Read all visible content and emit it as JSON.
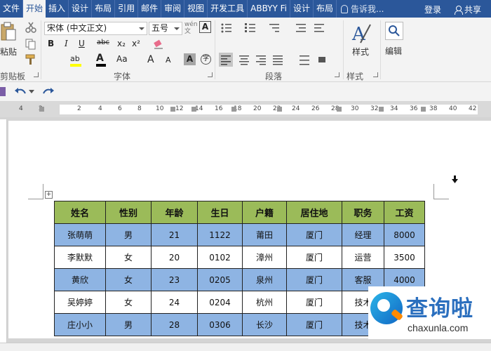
{
  "tabs": [
    {
      "label": "文件"
    },
    {
      "label": "开始"
    },
    {
      "label": "插入"
    },
    {
      "label": "设计"
    },
    {
      "label": "布局"
    },
    {
      "label": "引用"
    },
    {
      "label": "邮件"
    },
    {
      "label": "审阅"
    },
    {
      "label": "视图"
    },
    {
      "label": "开发工具"
    },
    {
      "label": "ABBYY Fi"
    },
    {
      "label": "设计"
    },
    {
      "label": "布局"
    }
  ],
  "tell_me": "告诉我...",
  "login": "登录",
  "share": "共享",
  "ribbon": {
    "clipboard": {
      "paste": "粘贴",
      "label": "剪贴板"
    },
    "font": {
      "name": "宋体 (中文正文)",
      "size": "五号",
      "label": "字体",
      "bold": "B",
      "italic": "I",
      "underline": "U",
      "strike": "abc",
      "subscript": "x₂",
      "superscript": "x²",
      "grow": "A",
      "shrink": "A",
      "aa": "Aa"
    },
    "paragraph": {
      "label": "段落"
    },
    "styles": {
      "button": "样式",
      "label": "样式"
    },
    "editing": {
      "button": "编辑"
    }
  },
  "ruler": [
    "4",
    "2",
    "2",
    "4",
    "6",
    "8",
    "10",
    "12",
    "14",
    "16",
    "18",
    "20",
    "22",
    "24",
    "26",
    "28",
    "30",
    "32",
    "34",
    "36",
    "38",
    "40",
    "42"
  ],
  "table": {
    "headers": [
      "姓名",
      "性别",
      "年龄",
      "生日",
      "户籍",
      "居住地",
      "职务",
      "工资"
    ],
    "rows": [
      [
        "张萌萌",
        "男",
        "21",
        "1122",
        "莆田",
        "厦门",
        "经理",
        "8000"
      ],
      [
        "李默默",
        "女",
        "20",
        "0102",
        "漳州",
        "厦门",
        "运营",
        "3500"
      ],
      [
        "黄欣",
        "女",
        "23",
        "0205",
        "泉州",
        "厦门",
        "客服",
        "4000"
      ],
      [
        "吴婷婷",
        "女",
        "24",
        "0204",
        "杭州",
        "厦门",
        "技术",
        ""
      ],
      [
        "庄小小",
        "男",
        "28",
        "0306",
        "长沙",
        "厦门",
        "技术",
        ""
      ]
    ]
  },
  "watermark": {
    "cn": "查询啦",
    "en": "chaxunla.com"
  }
}
